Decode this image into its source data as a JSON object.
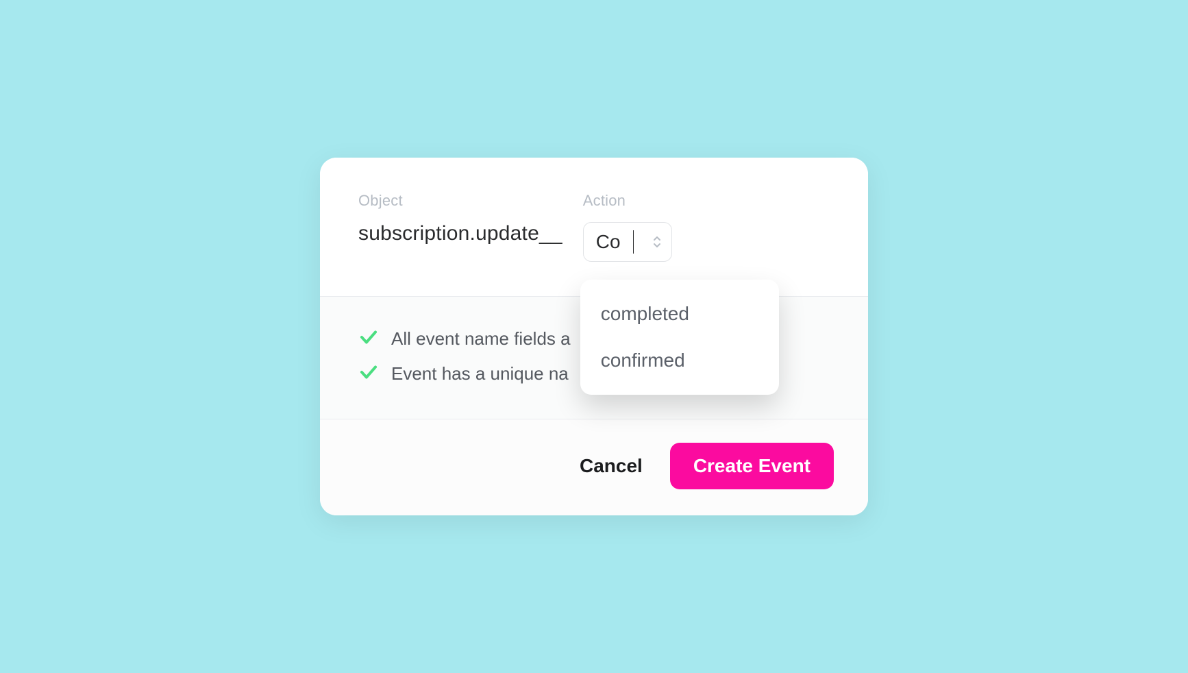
{
  "form": {
    "object": {
      "label": "Object",
      "value": "subscription.update__"
    },
    "action": {
      "label": "Action",
      "typed": "Co",
      "options": [
        "completed",
        "confirmed"
      ]
    }
  },
  "checks": [
    {
      "ok": true,
      "text": "All event name fields a"
    },
    {
      "ok": true,
      "text": "Event has a unique na"
    }
  ],
  "footer": {
    "cancel": "Cancel",
    "primary": "Create Event"
  },
  "colors": {
    "background": "#a6e8ee",
    "accent": "#fb0b9f",
    "check_ok": "#4ade80"
  }
}
